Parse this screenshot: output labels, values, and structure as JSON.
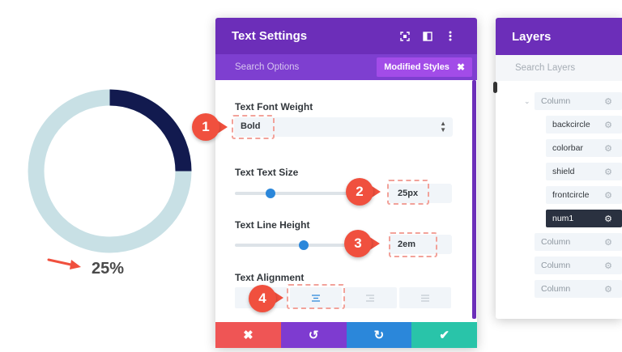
{
  "preview": {
    "percent_label": "25%",
    "progress_fraction": 0.25,
    "colors": {
      "track": "#c8e0e5",
      "bar": "#121a4f",
      "arrow": "#f0503e"
    }
  },
  "settings": {
    "title": "Text Settings",
    "icons": [
      "focus-icon",
      "split-view-icon",
      "more-vertical-icon"
    ],
    "search_placeholder": "Search Options",
    "modified_styles": "Modified Styles",
    "font_weight": {
      "label": "Text Font Weight",
      "value": "Bold"
    },
    "text_size": {
      "label": "Text Text Size",
      "value": "25px",
      "slider_fraction": 0.27
    },
    "line_height": {
      "label": "Text Line Height",
      "value": "2em",
      "slider_fraction": 0.52
    },
    "alignment": {
      "label": "Text Alignment",
      "options": [
        "align-left-icon",
        "align-center-icon",
        "align-right-icon",
        "align-justify-icon"
      ],
      "selected": "align-center-icon"
    },
    "footer_buttons": [
      {
        "name": "discard-button",
        "icon": "close-icon",
        "glyph": "✖",
        "color": "#ef5555"
      },
      {
        "name": "undo-button",
        "icon": "undo-icon",
        "glyph": "↺",
        "color": "#7e3bd0"
      },
      {
        "name": "redo-button",
        "icon": "redo-icon",
        "glyph": "↻",
        "color": "#2b87da"
      },
      {
        "name": "save-button",
        "icon": "check-icon",
        "glyph": "✔",
        "color": "#29c4a9"
      }
    ],
    "colors": {
      "header": "#6c2eb9",
      "subheader": "#7e3fd0",
      "modified": "#a24ce8",
      "accent": "#2b87da"
    }
  },
  "callouts": [
    "1",
    "2",
    "3",
    "4"
  ],
  "layers": {
    "title": "Layers",
    "search_placeholder": "Search Layers",
    "items": [
      {
        "label": "Column",
        "level": 0
      },
      {
        "label": "backcircle",
        "level": 1
      },
      {
        "label": "colorbar",
        "level": 1
      },
      {
        "label": "shield",
        "level": 1
      },
      {
        "label": "frontcircle",
        "level": 1
      },
      {
        "label": "num1",
        "level": 1,
        "selected": true
      },
      {
        "label": "Column",
        "level": 0
      },
      {
        "label": "Column",
        "level": 0
      },
      {
        "label": "Column",
        "level": 0
      }
    ]
  }
}
